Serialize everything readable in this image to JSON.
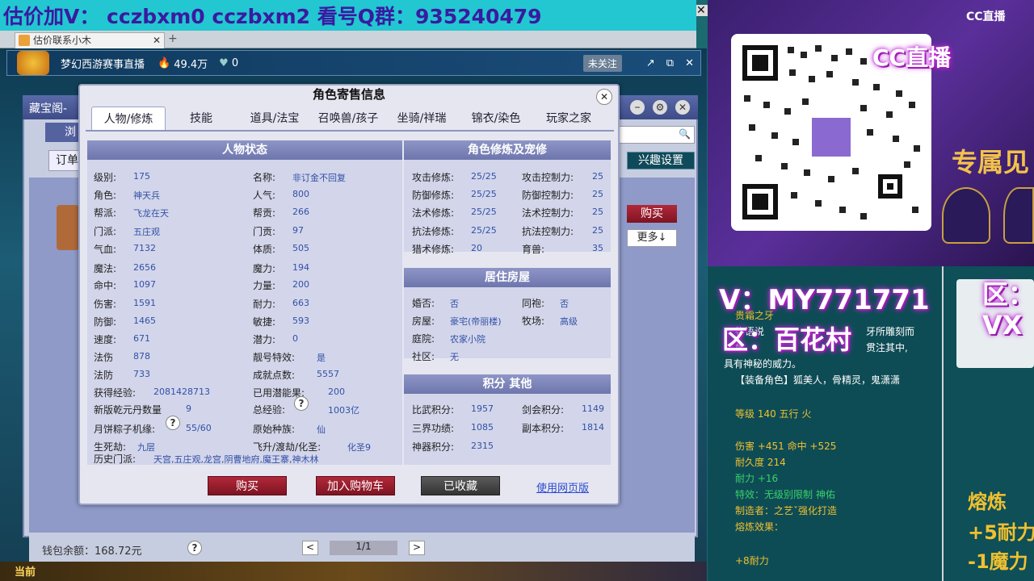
{
  "banner": {
    "text": "估价加V：  cczbxm0   cczbxm2   看号Q群：935240479"
  },
  "browser": {
    "tab_label": "估价联系小木",
    "new_tab": "+"
  },
  "stream": {
    "title": "梦幻西游赛事直播",
    "heat": "49.4万",
    "likes": "0",
    "follow": "未关注"
  },
  "back_window": {
    "title": "藏宝阁-",
    "order_btn": "订单",
    "tab_partial": "浏",
    "interest_btn": "兴趣设置",
    "buy_btn": "购买",
    "more_btn": "更多↓",
    "wallet": "钱包余额：168.72元",
    "page": "1/1",
    "prev": "<",
    "next": ">",
    "q": "?"
  },
  "modal": {
    "title": "角色寄售信息",
    "tabs": [
      "人物/修炼",
      "技能",
      "道具/法宝",
      "召唤兽/孩子",
      "坐骑/祥瑞",
      "锦衣/染色",
      "玩家之家"
    ],
    "status_header": "人物状态",
    "status_left": [
      {
        "k": "级别:",
        "v": "175"
      },
      {
        "k": "角色:",
        "v": "神天兵"
      },
      {
        "k": "帮派:",
        "v": "飞龙在天"
      },
      {
        "k": "门派:",
        "v": "五庄观"
      },
      {
        "k": "气血:",
        "v": "7132"
      },
      {
        "k": "魔法:",
        "v": "2656"
      },
      {
        "k": "命中:",
        "v": "1097"
      },
      {
        "k": "伤害:",
        "v": "1591"
      },
      {
        "k": "防御:",
        "v": "1465"
      },
      {
        "k": "速度:",
        "v": "671"
      },
      {
        "k": "法伤",
        "v": "878"
      },
      {
        "k": "法防",
        "v": "733"
      },
      {
        "k": "获得经验:",
        "v": "2081428713"
      },
      {
        "k": "新版乾元丹数量",
        "v": "9"
      },
      {
        "k": "月饼粽子机缘:",
        "v": "55/60"
      },
      {
        "k": "生死劫:",
        "v": "九层"
      }
    ],
    "status_right": [
      {
        "k": "名称:",
        "v": "非订金不回复"
      },
      {
        "k": "人气:",
        "v": "800"
      },
      {
        "k": "帮贡:",
        "v": "266"
      },
      {
        "k": "门贡:",
        "v": "97"
      },
      {
        "k": "体质:",
        "v": "505"
      },
      {
        "k": "魔力:",
        "v": "194"
      },
      {
        "k": "力量:",
        "v": "200"
      },
      {
        "k": "耐力:",
        "v": "663"
      },
      {
        "k": "敏捷:",
        "v": "593"
      },
      {
        "k": "潜力:",
        "v": "0"
      },
      {
        "k": "靓号特效:",
        "v": "是"
      },
      {
        "k": "成就点数:",
        "v": "5557"
      },
      {
        "k": "已用潜能果:",
        "v": "200"
      },
      {
        "k": "总经验:",
        "v": "1003亿"
      },
      {
        "k": "原始种族:",
        "v": "仙"
      },
      {
        "k": "飞升/渡劫/化圣:",
        "v": "化圣9"
      }
    ],
    "history_label": "历史门派:",
    "history_value": "天宫,五庄观,龙宫,阴曹地府,魔王寨,神木林",
    "cult_header": "角色修炼及宠修",
    "cult": [
      {
        "k": "攻击修炼:",
        "v": "25/25",
        "k2": "攻击控制力:",
        "v2": "25"
      },
      {
        "k": "防御修炼:",
        "v": "25/25",
        "k2": "防御控制力:",
        "v2": "25"
      },
      {
        "k": "法术修炼:",
        "v": "25/25",
        "k2": "法术控制力:",
        "v2": "25"
      },
      {
        "k": "抗法修炼:",
        "v": "25/25",
        "k2": "抗法控制力:",
        "v2": "25"
      },
      {
        "k": "猎术修炼:",
        "v": "20",
        "k2": "育兽:",
        "v2": "35"
      }
    ],
    "house_header": "居住房屋",
    "house": [
      {
        "k": "婚否:",
        "v": "否",
        "k2": "同袍:",
        "v2": "否"
      },
      {
        "k": "房屋:",
        "v": "豪宅(帝丽楼)",
        "k2": "牧场:",
        "v2": "高级"
      },
      {
        "k": "庭院:",
        "v": "农家小院",
        "k2": "",
        "v2": ""
      },
      {
        "k": "社区:",
        "v": "无",
        "k2": "",
        "v2": ""
      }
    ],
    "score_header": "积分 其他",
    "score": [
      {
        "k": "比武积分:",
        "v": "1957",
        "k2": "剑会积分:",
        "v2": "1149"
      },
      {
        "k": "三界功绩:",
        "v": "1085",
        "k2": "副本积分:",
        "v2": "1814"
      },
      {
        "k": "神器积分:",
        "v": "2315",
        "k2": "",
        "v2": ""
      }
    ],
    "buttons": {
      "buy": "购买",
      "cart": "加入购物车",
      "fav": "已收藏",
      "web": "使用网页版"
    }
  },
  "right": {
    "cc_logo": "CC直播",
    "cc_logo_big": "CC直播",
    "promo": "专属见",
    "neon_v": "V：MY771771",
    "neon_area": "区：百花村",
    "neon_area2": "区：",
    "neon_vx": "VX",
    "tip": {
      "name": "贵霜之牙",
      "desc1": "牙所雕刻而",
      "desc2": "贯注其中,",
      "desc3": "具有神秘的威力。",
      "roles": "【装备角色】狐美人，骨精灵，鬼潇潇",
      "level": "等级 140 五行 火",
      "dmg": "伤害 +451 命中 +525",
      "dura": "耐久度 214",
      "endur": "耐力 +16",
      "effect": "特效：无级别限制 神佑",
      "maker": "制造者：之艺ˇ强化打造",
      "melt": "熔炼效果：",
      "melt_val": "+8耐力",
      "partial1": "物语说",
      "partial2": "如"
    },
    "melt_title": "熔炼",
    "melt_l1": "+5耐力",
    "melt_l2": "-1魔力"
  },
  "taskbar": {
    "current": "当前"
  }
}
